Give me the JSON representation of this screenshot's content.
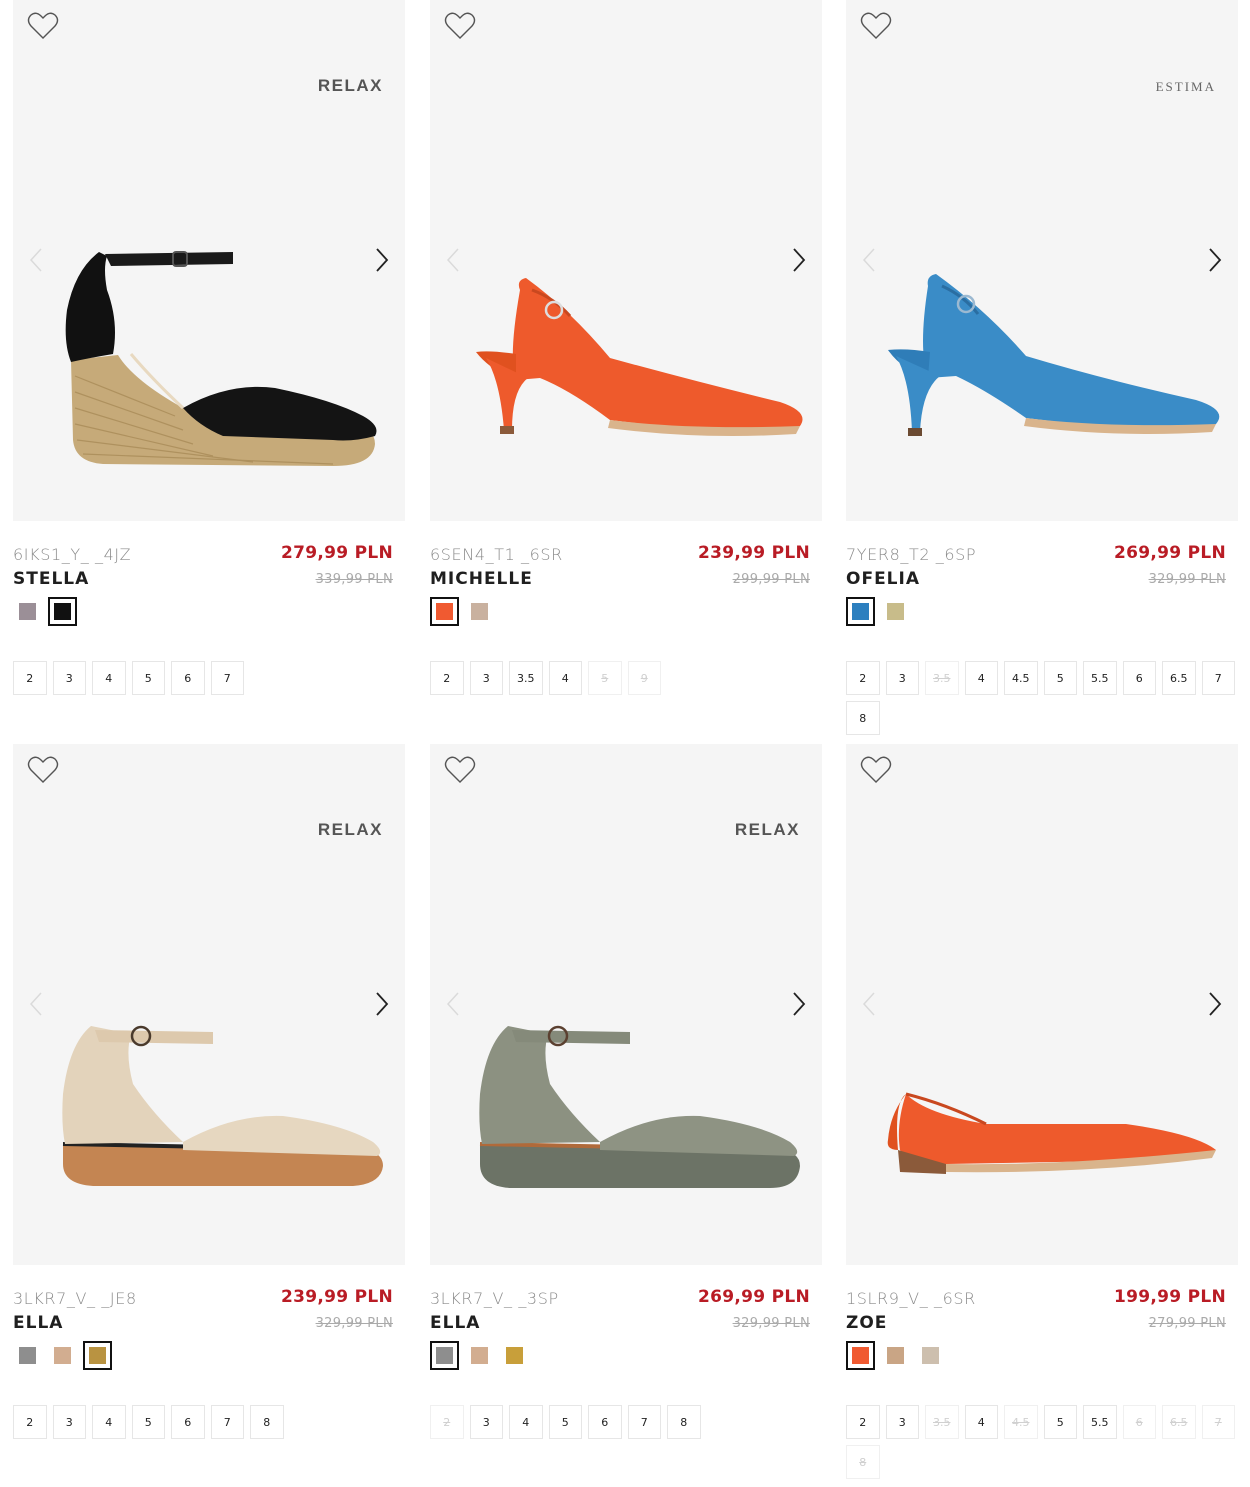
{
  "products": [
    {
      "brand": "RELAX",
      "brand_style": "sans",
      "code": "6IKS1_Y_ _4JZ",
      "name": "STELLA",
      "price": "279,99 PLN",
      "old_price": "339,99 PLN",
      "shoe": "wedge-black",
      "swatches": [
        {
          "color": "#9b8f97",
          "selected": false
        },
        {
          "color": "#111111",
          "selected": true
        }
      ],
      "sizes": [
        {
          "label": "2",
          "available": true
        },
        {
          "label": "3",
          "available": true
        },
        {
          "label": "4",
          "available": true
        },
        {
          "label": "5",
          "available": true
        },
        {
          "label": "6",
          "available": true
        },
        {
          "label": "7",
          "available": true
        }
      ]
    },
    {
      "brand": "",
      "brand_style": "sans",
      "code": "6SEN4_T1 _6SR",
      "name": "MICHELLE",
      "price": "239,99 PLN",
      "old_price": "299,99 PLN",
      "shoe": "slingback-orange",
      "swatches": [
        {
          "color": "#f05a31",
          "selected": true
        },
        {
          "color": "#c9b19f",
          "selected": false
        }
      ],
      "sizes": [
        {
          "label": "2",
          "available": true
        },
        {
          "label": "3",
          "available": true
        },
        {
          "label": "3.5",
          "available": true
        },
        {
          "label": "4",
          "available": true
        },
        {
          "label": "5",
          "available": false
        },
        {
          "label": "9",
          "available": false
        }
      ]
    },
    {
      "brand": "ESTIMA",
      "brand_style": "serif",
      "code": "7YER8_T2 _6SP",
      "name": "OFELIA",
      "price": "269,99 PLN",
      "old_price": "329,99 PLN",
      "shoe": "slingback-blue",
      "swatches": [
        {
          "color": "#2c7fbf",
          "selected": true
        },
        {
          "color": "#c8bc8a",
          "selected": false
        }
      ],
      "sizes": [
        {
          "label": "2",
          "available": true
        },
        {
          "label": "3",
          "available": true
        },
        {
          "label": "3.5",
          "available": false
        },
        {
          "label": "4",
          "available": true
        },
        {
          "label": "4.5",
          "available": true
        },
        {
          "label": "5",
          "available": true
        },
        {
          "label": "5.5",
          "available": true
        },
        {
          "label": "6",
          "available": true
        },
        {
          "label": "6.5",
          "available": true
        },
        {
          "label": "7",
          "available": true
        },
        {
          "label": "8",
          "available": true
        }
      ]
    },
    {
      "brand": "RELAX",
      "brand_style": "sans",
      "code": "3LKR7_V_ _JE8",
      "name": "ELLA",
      "price": "239,99 PLN",
      "old_price": "329,99 PLN",
      "shoe": "wedge-beige",
      "swatches": [
        {
          "color": "#8e8e8e",
          "selected": false
        },
        {
          "color": "#d2ad90",
          "selected": false
        },
        {
          "color": "#b99341",
          "selected": true
        }
      ],
      "sizes": [
        {
          "label": "2",
          "available": true
        },
        {
          "label": "3",
          "available": true
        },
        {
          "label": "4",
          "available": true
        },
        {
          "label": "5",
          "available": true
        },
        {
          "label": "6",
          "available": true
        },
        {
          "label": "7",
          "available": true
        },
        {
          "label": "8",
          "available": true
        }
      ]
    },
    {
      "brand": "RELAX",
      "brand_style": "sans",
      "code": "3LKR7_V_ _3SP",
      "name": "ELLA",
      "price": "269,99 PLN",
      "old_price": "329,99 PLN",
      "shoe": "wedge-grey",
      "swatches": [
        {
          "color": "#8e8e8e",
          "selected": true
        },
        {
          "color": "#d2ad90",
          "selected": false
        },
        {
          "color": "#c89f3a",
          "selected": false
        }
      ],
      "sizes": [
        {
          "label": "2",
          "available": false
        },
        {
          "label": "3",
          "available": true
        },
        {
          "label": "4",
          "available": true
        },
        {
          "label": "5",
          "available": true
        },
        {
          "label": "6",
          "available": true
        },
        {
          "label": "7",
          "available": true
        },
        {
          "label": "8",
          "available": true
        }
      ]
    },
    {
      "brand": "",
      "brand_style": "sans",
      "code": "1SLR9_V_ _6SR",
      "name": "ZOE",
      "price": "199,99 PLN",
      "old_price": "279,99 PLN",
      "shoe": "flat-orange",
      "swatches": [
        {
          "color": "#f05a31",
          "selected": true
        },
        {
          "color": "#c9a585",
          "selected": false
        },
        {
          "color": "#cdbfae",
          "selected": false
        }
      ],
      "sizes": [
        {
          "label": "2",
          "available": true
        },
        {
          "label": "3",
          "available": true
        },
        {
          "label": "3.5",
          "available": false
        },
        {
          "label": "4",
          "available": true
        },
        {
          "label": "4.5",
          "available": false
        },
        {
          "label": "5",
          "available": true
        },
        {
          "label": "5.5",
          "available": true
        },
        {
          "label": "6",
          "available": false
        },
        {
          "label": "6.5",
          "available": false
        },
        {
          "label": "7",
          "available": false
        },
        {
          "label": "8",
          "available": false
        }
      ]
    }
  ]
}
